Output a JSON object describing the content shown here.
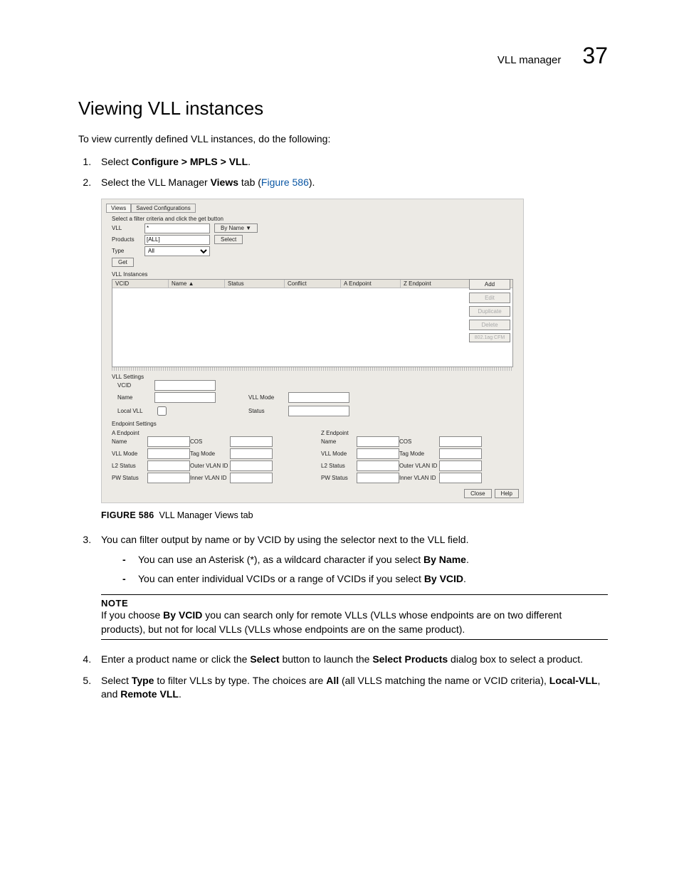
{
  "header": {
    "title": "VLL manager",
    "chapter": "37"
  },
  "h1": "Viewing VLL instances",
  "intro": "To view currently defined VLL instances, do the following:",
  "step1_a": "Select ",
  "step1_b": "Configure > MPLS > VLL",
  "step1_c": ".",
  "step2_a": "Select the VLL Manager ",
  "step2_b": "Views",
  "step2_c": " tab (",
  "step2_link": "Figure 586",
  "step2_d": ").",
  "shot": {
    "tabs": {
      "views": "Views",
      "saved": "Saved Configurations"
    },
    "filter_hint": "Select a filter criteria and click the get button",
    "vll_label": "VLL",
    "vll_value": "*",
    "byname": "By Name ▼",
    "products_label": "Products",
    "products_value": "[ALL]",
    "select_btn": "Select",
    "type_label": "Type",
    "type_value": "All",
    "get_btn": "Get",
    "panel_instances": "VLL Instances",
    "cols": {
      "vcid": "VCID",
      "name": "Name  ▲",
      "status": "Status",
      "conflict": "Conflict",
      "aep": "A Endpoint",
      "zep": "Z Endpoint"
    },
    "rbtns": {
      "add": "Add",
      "edit": "Edit",
      "dup": "Duplicate",
      "del": "Delete",
      "cfm": "802.1ag CFM"
    },
    "vll_settings": "VLL Settings",
    "fs": {
      "vcid": "VCID",
      "name": "Name",
      "local": "Local VLL",
      "vllmode": "VLL Mode",
      "status": "Status"
    },
    "ep_settings": "Endpoint Settings",
    "aep_title": "A Endpoint",
    "zep_title": "Z Endpoint",
    "ep": {
      "name": "Name",
      "cos": "COS",
      "vllmode": "VLL Mode",
      "tagmode": "Tag Mode",
      "l2": "L2 Status",
      "outer": "Outer VLAN ID",
      "pw": "PW Status",
      "inner": "Inner VLAN ID"
    },
    "close": "Close",
    "help": "Help"
  },
  "fig_label": "FIGURE 586",
  "fig_caption": "VLL Manager Views tab",
  "step3": "You can filter output by name or by VCID by using the selector next to the VLL field.",
  "sub1_a": "You can use an Asterisk (*), as a wildcard character if you select ",
  "sub1_b": "By Name",
  "sub1_c": ".",
  "sub2_a": "You can enter individual VCIDs or a range of VCIDs if you select ",
  "sub2_b": "By VCID",
  "sub2_c": ".",
  "note_title": "NOTE",
  "note_a": "If you choose ",
  "note_b": "By VCID",
  "note_c": " you can search only for remote VLLs (VLLs whose endpoints are on two different products), but not for local VLLs (VLLs whose endpoints are on the same product).",
  "step4_a": "Enter a product name or click the ",
  "step4_b": "Select",
  "step4_c": " button to launch the ",
  "step4_d": "Select Products",
  "step4_e": " dialog box to select a product.",
  "step5_a": "Select ",
  "step5_b": "Type",
  "step5_c": " to filter VLLs by type. The choices are ",
  "step5_d": "All",
  "step5_e": " (all VLLS matching the name or VCID criteria), ",
  "step5_f": "Local-VLL",
  "step5_g": ", and ",
  "step5_h": "Remote VLL",
  "step5_i": "."
}
